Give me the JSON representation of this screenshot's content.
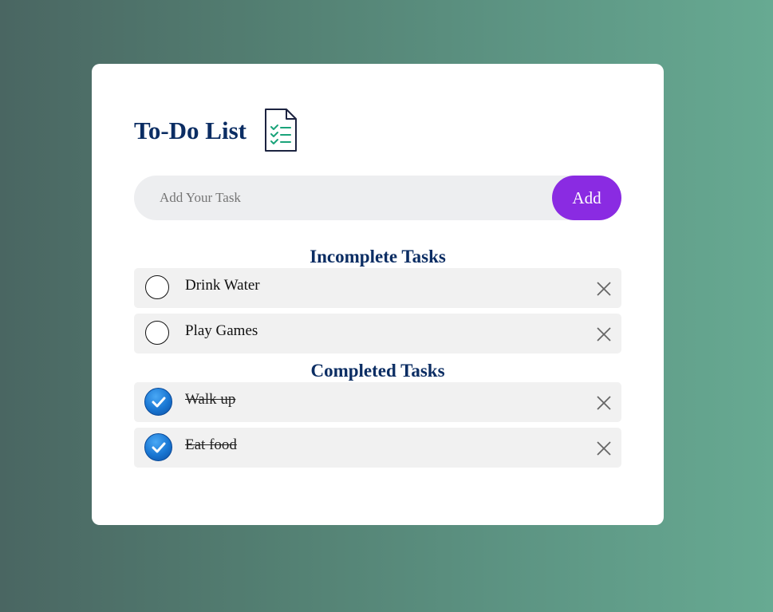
{
  "app": {
    "title": "To-Do List",
    "title_icon": "checklist-document-icon"
  },
  "add_task": {
    "placeholder": "Add Your Task",
    "value": "",
    "button_label": "Add"
  },
  "sections": {
    "incomplete": {
      "heading": "Incomplete Tasks",
      "tasks": [
        {
          "label": "Drink Water",
          "completed": false
        },
        {
          "label": "Play Games",
          "completed": false
        }
      ]
    },
    "completed": {
      "heading": "Completed Tasks",
      "tasks": [
        {
          "label": "Walk up",
          "completed": true
        },
        {
          "label": "Eat food",
          "completed": true
        }
      ]
    }
  },
  "colors": {
    "accent": "#8a2be2",
    "heading": "#0b2d63",
    "checked": "#1976d2",
    "row_bg": "#f1f1f1",
    "input_bg": "#edeef0"
  },
  "icons": {
    "unchecked": "empty-circle-icon",
    "checked": "checked-circle-icon",
    "delete": "close-icon"
  }
}
